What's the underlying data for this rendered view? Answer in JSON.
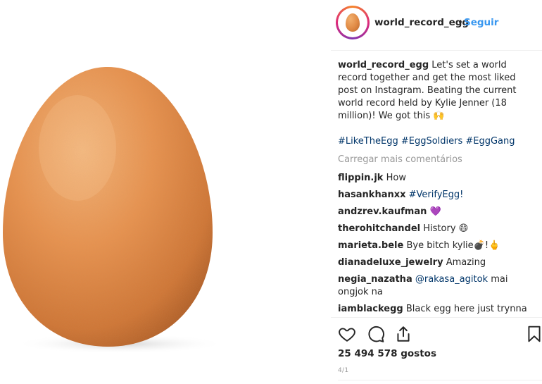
{
  "post": {
    "image_alt": "egg",
    "username": "world_record_egg",
    "separator": "•",
    "follow_label": "Seguir"
  },
  "caption": {
    "username": "world_record_egg",
    "text": "Let's set a world record together and get the most liked post on Instagram. Beating the current world record held by Kylie Jenner (18 million)! We got this",
    "emoji": "🙌",
    "hashtags": "#LikeTheEgg #EggSoldiers #EggGang"
  },
  "load_more_label": "Carregar mais comentários",
  "comments": [
    {
      "user": "flippin.jk",
      "text": "How"
    },
    {
      "user": "hasankhanxx",
      "text": "#VerifyEgg!"
    },
    {
      "user": "andzrev.kaufman",
      "text": "💜"
    },
    {
      "user": "therohitchandel",
      "text": "History 😄"
    },
    {
      "user": "marieta.bele",
      "text": "Bye bitch kylie💣!🖕"
    },
    {
      "user": "dianadeluxe_jewelry",
      "text": "Amazing"
    },
    {
      "user": "negia_nazatha",
      "mention": "@rakasa_agitok",
      "text": "mai ongjok na"
    },
    {
      "user": "iamblackegg",
      "text": "Black egg here just trynna"
    }
  ],
  "actions": {
    "like_icon": "heart-outline-icon",
    "comment_icon": "speech-bubble-icon",
    "share_icon": "share-upload-icon",
    "save_icon": "bookmark-icon"
  },
  "likes_text": "25 494 578 gostos",
  "time_text": "4/1",
  "colors": {
    "link": "#003569",
    "follow": "#3897f0",
    "muted": "#999999",
    "egg": "#e08a45"
  }
}
